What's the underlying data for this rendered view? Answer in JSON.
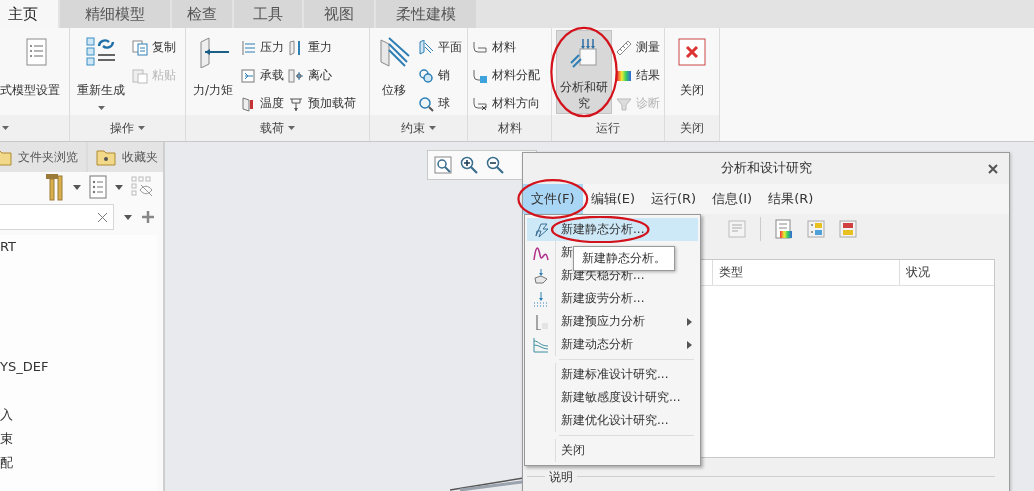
{
  "ribbon_tabs": [
    {
      "label": "主页",
      "selected": true
    },
    {
      "label": "精细模型",
      "selected": false
    },
    {
      "label": "检查",
      "selected": false
    },
    {
      "label": "工具",
      "selected": false
    },
    {
      "label": "视图",
      "selected": false
    },
    {
      "label": "柔性建模",
      "selected": false
    }
  ],
  "ribbon_groups": [
    {
      "has_menu": true,
      "items": [
        {
          "kind": "cut-text",
          "label": "式"
        },
        {
          "kind": "large",
          "label": "模型设置",
          "highlighted": false,
          "circled": false
        }
      ]
    },
    {
      "label": "操作",
      "has_menu": true,
      "items": [
        {
          "kind": "large",
          "label": "重新生成",
          "dropdown": true,
          "highlighted": false,
          "circled": false
        },
        {
          "kind": "column",
          "items": [
            {
              "label": "复制",
              "disabled": false
            },
            {
              "label": "粘贴",
              "disabled": true
            }
          ]
        }
      ]
    },
    {
      "label": "载荷",
      "has_menu": true,
      "items": [
        {
          "kind": "large",
          "label": "力/力矩",
          "highlighted": false,
          "circled": false
        },
        {
          "kind": "column",
          "items": [
            {
              "label": "压力",
              "disabled": false
            },
            {
              "label": "承载",
              "disabled": false
            },
            {
              "label": "温度",
              "disabled": false
            }
          ]
        },
        {
          "kind": "column",
          "items": [
            {
              "label": "重力",
              "disabled": false
            },
            {
              "label": "离心",
              "disabled": false
            },
            {
              "label": "预加载荷",
              "disabled": false
            }
          ]
        }
      ]
    },
    {
      "label": "约束",
      "has_menu": true,
      "items": [
        {
          "kind": "large",
          "label": "位移",
          "highlighted": false,
          "circled": false
        },
        {
          "kind": "column",
          "items": [
            {
              "label": "平面",
              "disabled": false
            },
            {
              "label": "销",
              "disabled": false
            },
            {
              "label": "球",
              "disabled": false
            }
          ]
        }
      ]
    },
    {
      "label": "材料",
      "has_menu": false,
      "items": [
        {
          "kind": "column",
          "items": [
            {
              "label": "材料",
              "disabled": false
            },
            {
              "label": "材料分配",
              "disabled": false
            },
            {
              "label": "材料方向",
              "disabled": false
            }
          ]
        }
      ]
    },
    {
      "label": "运行",
      "has_menu": false,
      "items": [
        {
          "kind": "large",
          "label": "分析和研究",
          "highlighted": true,
          "circled": true
        },
        {
          "kind": "column",
          "items": [
            {
              "label": "测量",
              "disabled": false
            },
            {
              "label": "结果",
              "disabled": false
            },
            {
              "label": "诊断",
              "disabled": true
            }
          ]
        }
      ]
    },
    {
      "label": "关闭",
      "has_menu": false,
      "items": [
        {
          "kind": "large",
          "label": "关闭",
          "highlighted": false,
          "circled": false
        }
      ]
    }
  ],
  "side_panel": {
    "tabs": [
      {
        "label": "文件夹浏览",
        "selected": false
      },
      {
        "label": "收藏夹",
        "selected": false
      }
    ],
    "tree": [
      {
        "kind": "item",
        "label": "RT"
      },
      {
        "kind": "blank"
      },
      {
        "kind": "blank"
      },
      {
        "kind": "blank"
      },
      {
        "kind": "blank"
      },
      {
        "kind": "item",
        "label": "YS_DEF"
      },
      {
        "kind": "blank"
      },
      {
        "kind": "item",
        "label": "入"
      },
      {
        "kind": "item",
        "label": "束"
      },
      {
        "kind": "item",
        "label": "配"
      }
    ]
  },
  "dialog": {
    "title": "分析和设计研究",
    "menu": [
      {
        "label": "文件(F)",
        "selected": true,
        "circled": true
      },
      {
        "label": "编辑(E)",
        "selected": false,
        "circled": false
      },
      {
        "label": "运行(R)",
        "selected": false,
        "circled": false
      },
      {
        "label": "信息(I)",
        "selected": false,
        "circled": false
      },
      {
        "label": "结果(R)",
        "selected": false,
        "circled": false
      }
    ],
    "table": {
      "columns": [
        "类型",
        "状况"
      ]
    },
    "description_label": "说明"
  },
  "file_menu": [
    {
      "kind": "item",
      "label": "新建静态分析...",
      "highlighted": true,
      "circled": true,
      "submenu": false
    },
    {
      "kind": "item",
      "label": "新",
      "highlighted": false,
      "circled": false,
      "submenu": false
    },
    {
      "kind": "item",
      "label": "新建失稳分析...",
      "highlighted": false,
      "circled": false,
      "submenu": false
    },
    {
      "kind": "item",
      "label": "新建疲劳分析...",
      "highlighted": false,
      "circled": false,
      "submenu": false
    },
    {
      "kind": "item",
      "label": "新建预应力分析",
      "highlighted": false,
      "circled": false,
      "submenu": true
    },
    {
      "kind": "item",
      "label": "新建动态分析",
      "highlighted": false,
      "circled": false,
      "submenu": true
    },
    {
      "kind": "separator"
    },
    {
      "kind": "item",
      "label": "新建标准设计研究...",
      "highlighted": false,
      "circled": false,
      "submenu": false
    },
    {
      "kind": "item",
      "label": "新建敏感度设计研究...",
      "highlighted": false,
      "circled": false,
      "submenu": false
    },
    {
      "kind": "item",
      "label": "新建优化设计研究...",
      "highlighted": false,
      "circled": false,
      "submenu": false
    },
    {
      "kind": "separator"
    },
    {
      "kind": "item",
      "label": "关闭",
      "highlighted": false,
      "circled": false,
      "submenu": false
    }
  ],
  "tooltip": {
    "text": "新建静态分析。"
  }
}
